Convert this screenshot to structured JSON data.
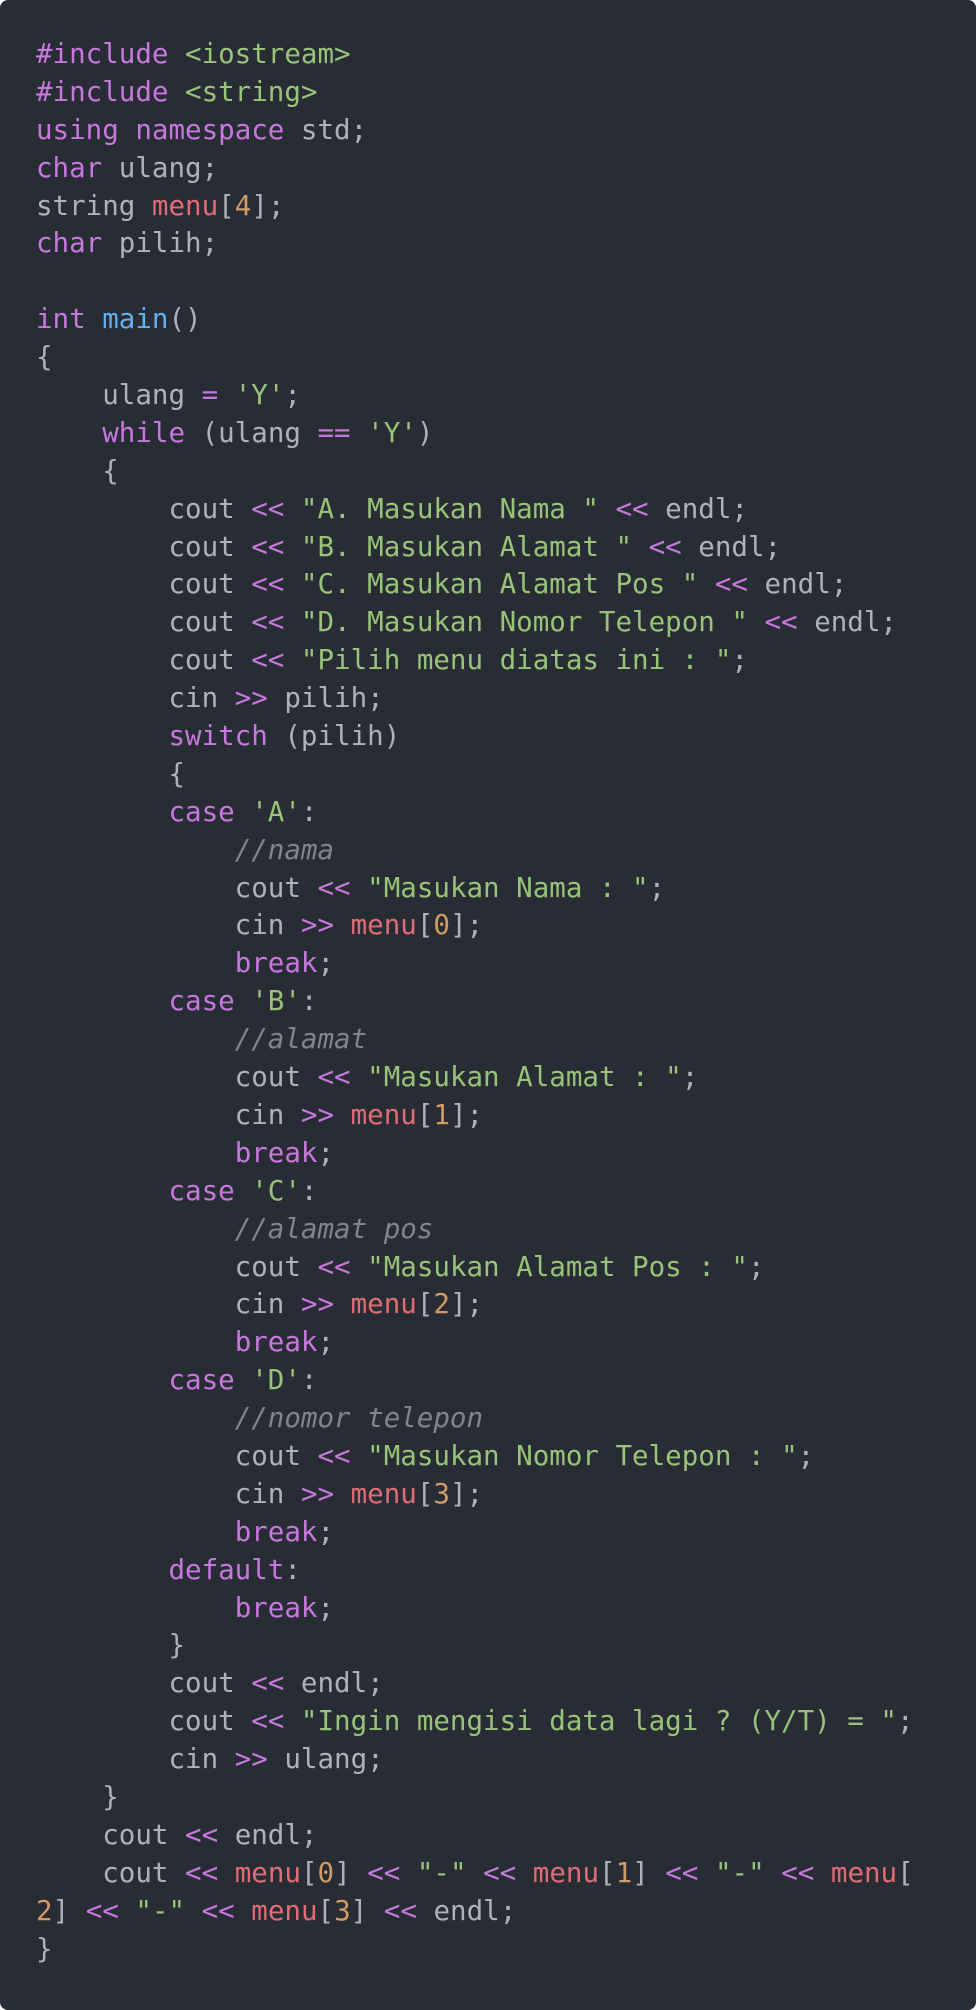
{
  "editor": {
    "language": "cpp",
    "theme": {
      "background": "#282c34",
      "text": "#abb2bf",
      "keyword": "#c678dd",
      "string": "#98c379",
      "function": "#61afef",
      "variable": "#e06c75",
      "number": "#d19a66",
      "comment": "#7f848e"
    },
    "lines": [
      [
        {
          "t": "kw",
          "v": "#include"
        },
        {
          "t": "p",
          "v": " "
        },
        {
          "t": "str",
          "v": "<iostream>"
        }
      ],
      [
        {
          "t": "kw",
          "v": "#include"
        },
        {
          "t": "p",
          "v": " "
        },
        {
          "t": "str",
          "v": "<string>"
        }
      ],
      [
        {
          "t": "kw",
          "v": "using"
        },
        {
          "t": "p",
          "v": " "
        },
        {
          "t": "kw",
          "v": "namespace"
        },
        {
          "t": "p",
          "v": " std;"
        }
      ],
      [
        {
          "t": "kw",
          "v": "char"
        },
        {
          "t": "p",
          "v": " ulang;"
        }
      ],
      [
        {
          "t": "p",
          "v": "string "
        },
        {
          "t": "var",
          "v": "menu"
        },
        {
          "t": "p",
          "v": "["
        },
        {
          "t": "num",
          "v": "4"
        },
        {
          "t": "p",
          "v": "];"
        }
      ],
      [
        {
          "t": "kw",
          "v": "char"
        },
        {
          "t": "p",
          "v": " pilih;"
        }
      ],
      [],
      [
        {
          "t": "kw",
          "v": "int"
        },
        {
          "t": "p",
          "v": " "
        },
        {
          "t": "fn",
          "v": "main"
        },
        {
          "t": "p",
          "v": "()"
        }
      ],
      [
        {
          "t": "p",
          "v": "{"
        }
      ],
      [
        {
          "t": "p",
          "v": "    ulang "
        },
        {
          "t": "op",
          "v": "="
        },
        {
          "t": "p",
          "v": " "
        },
        {
          "t": "str",
          "v": "'Y'"
        },
        {
          "t": "p",
          "v": ";"
        }
      ],
      [
        {
          "t": "p",
          "v": "    "
        },
        {
          "t": "kw",
          "v": "while"
        },
        {
          "t": "p",
          "v": " (ulang "
        },
        {
          "t": "op",
          "v": "=="
        },
        {
          "t": "p",
          "v": " "
        },
        {
          "t": "str",
          "v": "'Y'"
        },
        {
          "t": "p",
          "v": ")"
        }
      ],
      [
        {
          "t": "p",
          "v": "    {"
        }
      ],
      [
        {
          "t": "p",
          "v": "        cout "
        },
        {
          "t": "op",
          "v": "<<"
        },
        {
          "t": "p",
          "v": " "
        },
        {
          "t": "str",
          "v": "\"A. Masukan Nama \""
        },
        {
          "t": "p",
          "v": " "
        },
        {
          "t": "op",
          "v": "<<"
        },
        {
          "t": "p",
          "v": " endl;"
        }
      ],
      [
        {
          "t": "p",
          "v": "        cout "
        },
        {
          "t": "op",
          "v": "<<"
        },
        {
          "t": "p",
          "v": " "
        },
        {
          "t": "str",
          "v": "\"B. Masukan Alamat \""
        },
        {
          "t": "p",
          "v": " "
        },
        {
          "t": "op",
          "v": "<<"
        },
        {
          "t": "p",
          "v": " endl;"
        }
      ],
      [
        {
          "t": "p",
          "v": "        cout "
        },
        {
          "t": "op",
          "v": "<<"
        },
        {
          "t": "p",
          "v": " "
        },
        {
          "t": "str",
          "v": "\"C. Masukan Alamat Pos \""
        },
        {
          "t": "p",
          "v": " "
        },
        {
          "t": "op",
          "v": "<<"
        },
        {
          "t": "p",
          "v": " endl;"
        }
      ],
      [
        {
          "t": "p",
          "v": "        cout "
        },
        {
          "t": "op",
          "v": "<<"
        },
        {
          "t": "p",
          "v": " "
        },
        {
          "t": "str",
          "v": "\"D. Masukan Nomor Telepon \""
        },
        {
          "t": "p",
          "v": " "
        },
        {
          "t": "op",
          "v": "<<"
        },
        {
          "t": "p",
          "v": " endl;"
        }
      ],
      [
        {
          "t": "p",
          "v": "        cout "
        },
        {
          "t": "op",
          "v": "<<"
        },
        {
          "t": "p",
          "v": " "
        },
        {
          "t": "str",
          "v": "\"Pilih menu diatas ini : \""
        },
        {
          "t": "p",
          "v": ";"
        }
      ],
      [
        {
          "t": "p",
          "v": "        cin "
        },
        {
          "t": "op",
          "v": ">>"
        },
        {
          "t": "p",
          "v": " pilih;"
        }
      ],
      [
        {
          "t": "p",
          "v": "        "
        },
        {
          "t": "kw",
          "v": "switch"
        },
        {
          "t": "p",
          "v": " (pilih)"
        }
      ],
      [
        {
          "t": "p",
          "v": "        {"
        }
      ],
      [
        {
          "t": "p",
          "v": "        "
        },
        {
          "t": "kw",
          "v": "case"
        },
        {
          "t": "p",
          "v": " "
        },
        {
          "t": "str",
          "v": "'A'"
        },
        {
          "t": "p",
          "v": ":"
        }
      ],
      [
        {
          "t": "p",
          "v": "            "
        },
        {
          "t": "cmt",
          "v": "//nama"
        }
      ],
      [
        {
          "t": "p",
          "v": "            cout "
        },
        {
          "t": "op",
          "v": "<<"
        },
        {
          "t": "p",
          "v": " "
        },
        {
          "t": "str",
          "v": "\"Masukan Nama : \""
        },
        {
          "t": "p",
          "v": ";"
        }
      ],
      [
        {
          "t": "p",
          "v": "            cin "
        },
        {
          "t": "op",
          "v": ">>"
        },
        {
          "t": "p",
          "v": " "
        },
        {
          "t": "var",
          "v": "menu"
        },
        {
          "t": "p",
          "v": "["
        },
        {
          "t": "num",
          "v": "0"
        },
        {
          "t": "p",
          "v": "];"
        }
      ],
      [
        {
          "t": "p",
          "v": "            "
        },
        {
          "t": "kw",
          "v": "break"
        },
        {
          "t": "p",
          "v": ";"
        }
      ],
      [
        {
          "t": "p",
          "v": "        "
        },
        {
          "t": "kw",
          "v": "case"
        },
        {
          "t": "p",
          "v": " "
        },
        {
          "t": "str",
          "v": "'B'"
        },
        {
          "t": "p",
          "v": ":"
        }
      ],
      [
        {
          "t": "p",
          "v": "            "
        },
        {
          "t": "cmt",
          "v": "//alamat"
        }
      ],
      [
        {
          "t": "p",
          "v": "            cout "
        },
        {
          "t": "op",
          "v": "<<"
        },
        {
          "t": "p",
          "v": " "
        },
        {
          "t": "str",
          "v": "\"Masukan Alamat : \""
        },
        {
          "t": "p",
          "v": ";"
        }
      ],
      [
        {
          "t": "p",
          "v": "            cin "
        },
        {
          "t": "op",
          "v": ">>"
        },
        {
          "t": "p",
          "v": " "
        },
        {
          "t": "var",
          "v": "menu"
        },
        {
          "t": "p",
          "v": "["
        },
        {
          "t": "num",
          "v": "1"
        },
        {
          "t": "p",
          "v": "];"
        }
      ],
      [
        {
          "t": "p",
          "v": "            "
        },
        {
          "t": "kw",
          "v": "break"
        },
        {
          "t": "p",
          "v": ";"
        }
      ],
      [
        {
          "t": "p",
          "v": "        "
        },
        {
          "t": "kw",
          "v": "case"
        },
        {
          "t": "p",
          "v": " "
        },
        {
          "t": "str",
          "v": "'C'"
        },
        {
          "t": "p",
          "v": ":"
        }
      ],
      [
        {
          "t": "p",
          "v": "            "
        },
        {
          "t": "cmt",
          "v": "//alamat pos"
        }
      ],
      [
        {
          "t": "p",
          "v": "            cout "
        },
        {
          "t": "op",
          "v": "<<"
        },
        {
          "t": "p",
          "v": " "
        },
        {
          "t": "str",
          "v": "\"Masukan Alamat Pos : \""
        },
        {
          "t": "p",
          "v": ";"
        }
      ],
      [
        {
          "t": "p",
          "v": "            cin "
        },
        {
          "t": "op",
          "v": ">>"
        },
        {
          "t": "p",
          "v": " "
        },
        {
          "t": "var",
          "v": "menu"
        },
        {
          "t": "p",
          "v": "["
        },
        {
          "t": "num",
          "v": "2"
        },
        {
          "t": "p",
          "v": "];"
        }
      ],
      [
        {
          "t": "p",
          "v": "            "
        },
        {
          "t": "kw",
          "v": "break"
        },
        {
          "t": "p",
          "v": ";"
        }
      ],
      [
        {
          "t": "p",
          "v": "        "
        },
        {
          "t": "kw",
          "v": "case"
        },
        {
          "t": "p",
          "v": " "
        },
        {
          "t": "str",
          "v": "'D'"
        },
        {
          "t": "p",
          "v": ":"
        }
      ],
      [
        {
          "t": "p",
          "v": "            "
        },
        {
          "t": "cmt",
          "v": "//nomor telepon"
        }
      ],
      [
        {
          "t": "p",
          "v": "            cout "
        },
        {
          "t": "op",
          "v": "<<"
        },
        {
          "t": "p",
          "v": " "
        },
        {
          "t": "str",
          "v": "\"Masukan Nomor Telepon : \""
        },
        {
          "t": "p",
          "v": ";"
        }
      ],
      [
        {
          "t": "p",
          "v": "            cin "
        },
        {
          "t": "op",
          "v": ">>"
        },
        {
          "t": "p",
          "v": " "
        },
        {
          "t": "var",
          "v": "menu"
        },
        {
          "t": "p",
          "v": "["
        },
        {
          "t": "num",
          "v": "3"
        },
        {
          "t": "p",
          "v": "];"
        }
      ],
      [
        {
          "t": "p",
          "v": "            "
        },
        {
          "t": "kw",
          "v": "break"
        },
        {
          "t": "p",
          "v": ";"
        }
      ],
      [
        {
          "t": "p",
          "v": "        "
        },
        {
          "t": "kw",
          "v": "default"
        },
        {
          "t": "p",
          "v": ":"
        }
      ],
      [
        {
          "t": "p",
          "v": "            "
        },
        {
          "t": "kw",
          "v": "break"
        },
        {
          "t": "p",
          "v": ";"
        }
      ],
      [
        {
          "t": "p",
          "v": "        }"
        }
      ],
      [
        {
          "t": "p",
          "v": "        cout "
        },
        {
          "t": "op",
          "v": "<<"
        },
        {
          "t": "p",
          "v": " endl;"
        }
      ],
      [
        {
          "t": "p",
          "v": "        cout "
        },
        {
          "t": "op",
          "v": "<<"
        },
        {
          "t": "p",
          "v": " "
        },
        {
          "t": "str",
          "v": "\"Ingin mengisi data lagi ? (Y/T) = \""
        },
        {
          "t": "p",
          "v": ";"
        }
      ],
      [
        {
          "t": "p",
          "v": "        cin "
        },
        {
          "t": "op",
          "v": ">>"
        },
        {
          "t": "p",
          "v": " ulang;"
        }
      ],
      [
        {
          "t": "p",
          "v": "    }"
        }
      ],
      [
        {
          "t": "p",
          "v": "    cout "
        },
        {
          "t": "op",
          "v": "<<"
        },
        {
          "t": "p",
          "v": " endl;"
        }
      ],
      [
        {
          "t": "p",
          "v": "    cout "
        },
        {
          "t": "op",
          "v": "<<"
        },
        {
          "t": "p",
          "v": " "
        },
        {
          "t": "var",
          "v": "menu"
        },
        {
          "t": "p",
          "v": "["
        },
        {
          "t": "num",
          "v": "0"
        },
        {
          "t": "p",
          "v": "] "
        },
        {
          "t": "op",
          "v": "<<"
        },
        {
          "t": "p",
          "v": " "
        },
        {
          "t": "str",
          "v": "\"-\""
        },
        {
          "t": "p",
          "v": " "
        },
        {
          "t": "op",
          "v": "<<"
        },
        {
          "t": "p",
          "v": " "
        },
        {
          "t": "var",
          "v": "menu"
        },
        {
          "t": "p",
          "v": "["
        },
        {
          "t": "num",
          "v": "1"
        },
        {
          "t": "p",
          "v": "] "
        },
        {
          "t": "op",
          "v": "<<"
        },
        {
          "t": "p",
          "v": " "
        },
        {
          "t": "str",
          "v": "\"-\""
        },
        {
          "t": "p",
          "v": " "
        },
        {
          "t": "op",
          "v": "<<"
        },
        {
          "t": "p",
          "v": " "
        },
        {
          "t": "var",
          "v": "menu"
        },
        {
          "t": "p",
          "v": "["
        }
      ],
      [
        {
          "t": "num",
          "v": "2"
        },
        {
          "t": "p",
          "v": "] "
        },
        {
          "t": "op",
          "v": "<<"
        },
        {
          "t": "p",
          "v": " "
        },
        {
          "t": "str",
          "v": "\"-\""
        },
        {
          "t": "p",
          "v": " "
        },
        {
          "t": "op",
          "v": "<<"
        },
        {
          "t": "p",
          "v": " "
        },
        {
          "t": "var",
          "v": "menu"
        },
        {
          "t": "p",
          "v": "["
        },
        {
          "t": "num",
          "v": "3"
        },
        {
          "t": "p",
          "v": "] "
        },
        {
          "t": "op",
          "v": "<<"
        },
        {
          "t": "p",
          "v": " endl;"
        }
      ],
      [
        {
          "t": "p",
          "v": "}"
        }
      ]
    ]
  }
}
